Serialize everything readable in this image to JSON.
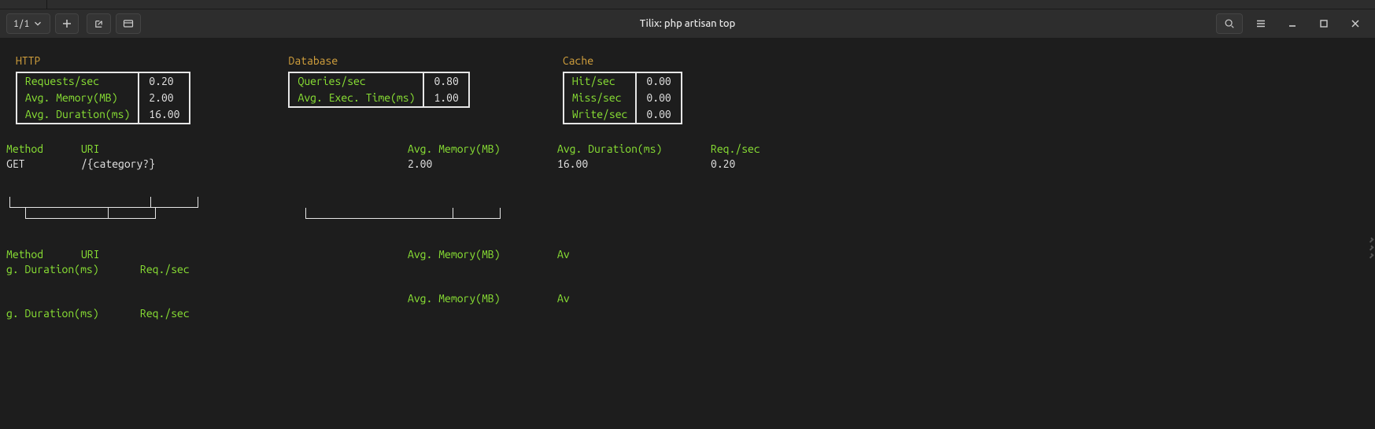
{
  "window": {
    "pager": "1/1",
    "title": "Tilix: php artisan top"
  },
  "sections": {
    "http": {
      "title": "HTTP",
      "rows": [
        {
          "label": "Requests/sec",
          "value": "0.20"
        },
        {
          "label": "Avg. Memory(MB)",
          "value": "2.00"
        },
        {
          "label": "Avg. Duration(ms)",
          "value": "16.00"
        }
      ]
    },
    "database": {
      "title": "Database",
      "rows": [
        {
          "label": "Queries/sec",
          "value": "0.80"
        },
        {
          "label": "Avg. Exec. Time(ms)",
          "value": "1.00"
        }
      ]
    },
    "cache": {
      "title": "Cache",
      "rows": [
        {
          "label": "Hit/sec",
          "value": "0.00"
        },
        {
          "label": "Miss/sec",
          "value": "0.00"
        },
        {
          "label": "Write/sec",
          "value": "0.00"
        }
      ]
    }
  },
  "table1": {
    "headers": {
      "method": "Method",
      "uri": "URI",
      "mem": "Avg. Memory(MB)",
      "dur": "Avg. Duration(ms)",
      "req": "Req./sec"
    },
    "row": {
      "method": "GET",
      "uri": "/{category?}",
      "mem": "2.00",
      "dur": "16.00",
      "req": "0.20"
    }
  },
  "frag": {
    "l1a": "Method",
    "l1b": "URI",
    "l1c": "Avg. Memory(MB)",
    "l1d": "Av",
    "l2a": "g. Duration(ms)",
    "l2b": "Req./sec",
    "l3a": "Avg. Memory(MB)",
    "l3b": "Av",
    "l4a": "g. Duration(ms)",
    "l4b": "Req./sec"
  }
}
